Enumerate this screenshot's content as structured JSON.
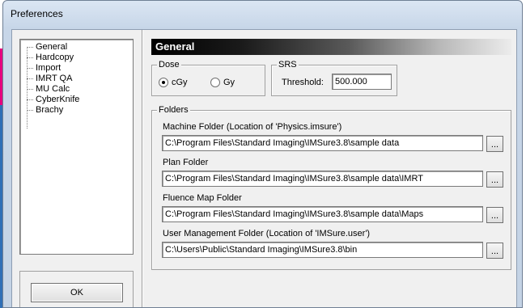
{
  "window": {
    "title": "Preferences"
  },
  "tree": {
    "items": [
      "General",
      "Hardcopy",
      "Import",
      "IMRT QA",
      "MU Calc",
      "CyberKnife",
      "Brachy"
    ]
  },
  "ok_label": "OK",
  "panel": {
    "header": "General",
    "dose": {
      "label": "Dose",
      "options": [
        "cGy",
        "Gy"
      ],
      "selected": "cGy"
    },
    "srs": {
      "label": "SRS",
      "threshold_label": "Threshold:",
      "threshold_value": "500.000"
    },
    "folders": {
      "label": "Folders",
      "browse_label": "...",
      "items": [
        {
          "label": "Machine Folder (Location of 'Physics.imsure')",
          "value": "C:\\Program Files\\Standard Imaging\\IMSure3.8\\sample data"
        },
        {
          "label": "Plan Folder",
          "value": "C:\\Program Files\\Standard Imaging\\IMSure3.8\\sample data\\IMRT"
        },
        {
          "label": "Fluence Map Folder",
          "value": "C:\\Program Files\\Standard Imaging\\IMSure3.8\\sample data\\Maps"
        },
        {
          "label": "User Management Folder (Location of 'IMSure.user')",
          "value": "C:\\Users\\Public\\Standard Imaging\\IMSure3.8\\bin"
        }
      ]
    }
  },
  "colors": {
    "background_accent": "#e6007e",
    "background_blue": "#2f6fb6",
    "header_gradient_start": "#000000"
  }
}
